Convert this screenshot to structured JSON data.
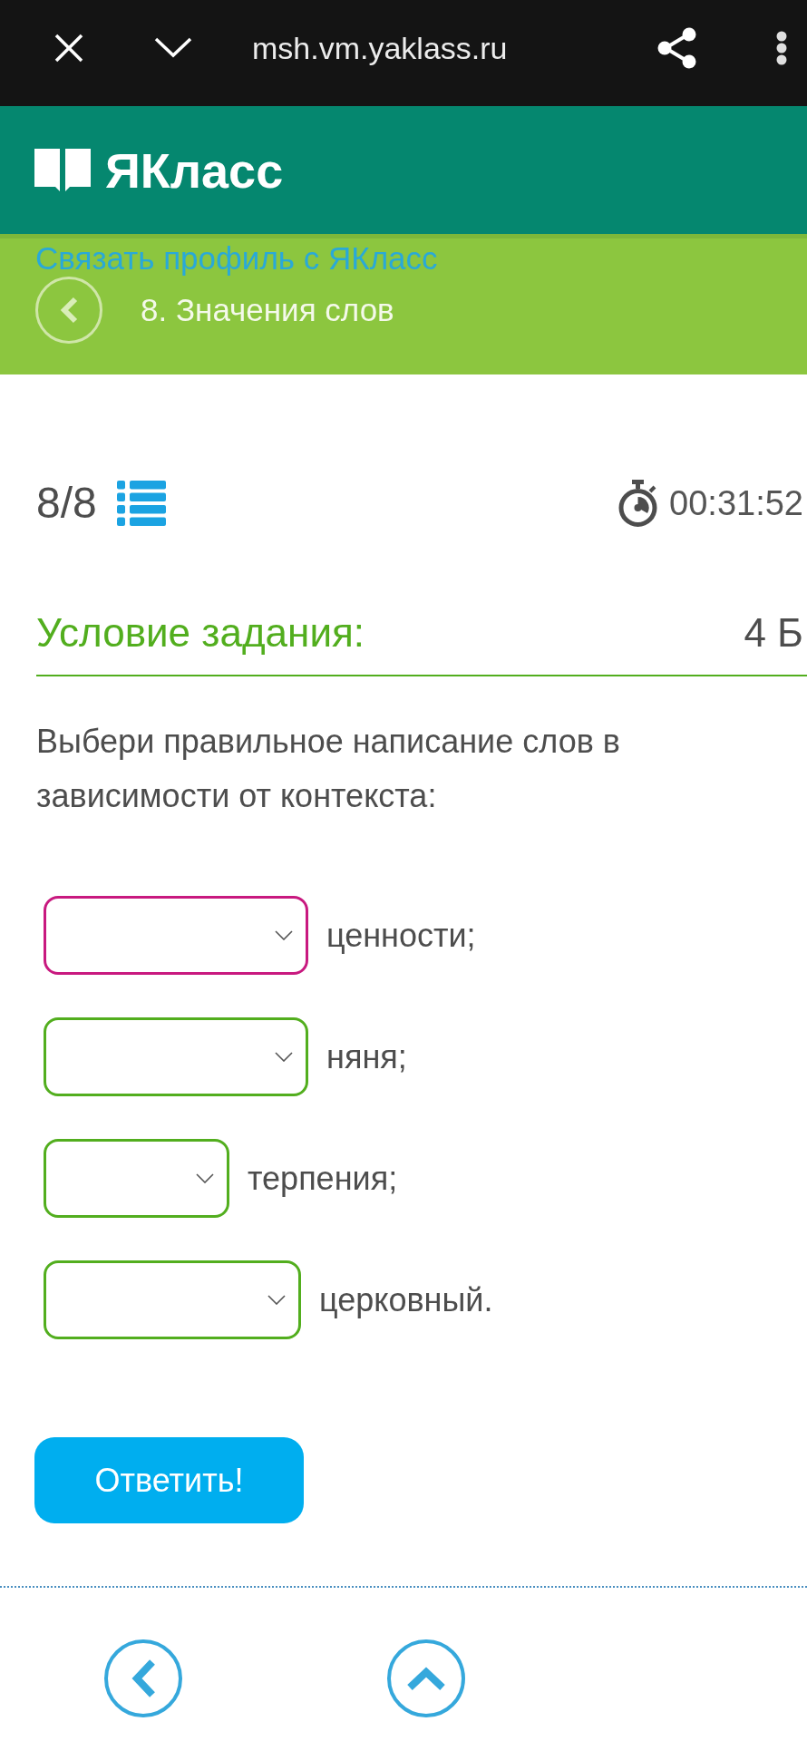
{
  "browser_bar": {
    "url": "msh.vm.yaklass.ru"
  },
  "site_header": {
    "logo": "ЯКласс"
  },
  "topic_bar": {
    "link": "Связать профиль с ЯКласс",
    "title": "8. Значения слов"
  },
  "progress": {
    "counter": "8/8",
    "timer": "00:31:52"
  },
  "task": {
    "heading": "Условие задания:",
    "points": "4 Б",
    "instruction": "Выбери правильное написание слов в зависимости от контекста:",
    "blanks": [
      {
        "word": "ценности;",
        "focused": true
      },
      {
        "word": "няня;",
        "focused": false
      },
      {
        "word": "терпения;",
        "focused": false
      },
      {
        "word": "церковный.",
        "focused": false
      }
    ]
  },
  "submit_button": "Ответить!"
}
